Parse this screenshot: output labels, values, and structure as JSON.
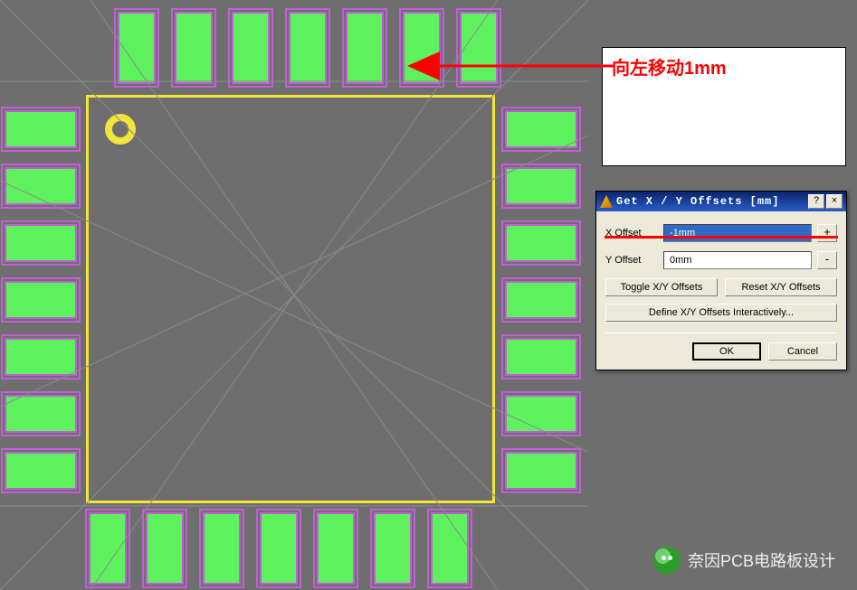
{
  "annotation": {
    "text": "向左移动1mm"
  },
  "dialog": {
    "title": "Get X / Y Offsets [mm]",
    "help_label": "?",
    "close_label": "×",
    "x_label": "X Offset",
    "x_value": "-1mm",
    "x_pm": "+",
    "y_label": "Y Offset",
    "y_value": "0mm",
    "y_pm": "-",
    "toggle_label": "Toggle X/Y Offsets",
    "reset_label": "Reset X/Y Offsets",
    "define_label": "Define X/Y Offsets Interactively...",
    "ok_label": "OK",
    "cancel_label": "Cancel"
  },
  "watermark": {
    "text": "奈因PCB电路板设计"
  }
}
